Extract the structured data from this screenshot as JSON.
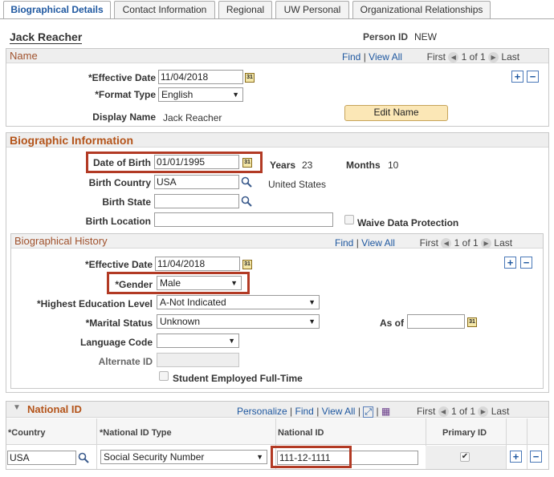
{
  "tabs": [
    "Biographical Details",
    "Contact Information",
    "Regional",
    "UW Personal",
    "Organizational Relationships"
  ],
  "person": {
    "name": "Jack Reacher",
    "person_id_label": "Person ID",
    "person_id_value": "NEW"
  },
  "name_section": {
    "title": "Name",
    "nav": {
      "find": "Find",
      "sep": "|",
      "view_all": "View All",
      "first": "First",
      "position": "1 of 1",
      "last": "Last"
    },
    "effective_date_label": "*Effective Date",
    "effective_date": "11/04/2018",
    "format_type_label": "*Format Type",
    "format_type": "English",
    "display_name_label": "Display Name",
    "display_name": "Jack Reacher",
    "edit_name_button": "Edit Name"
  },
  "bio_info": {
    "title": "Biographic Information",
    "dob_label": "Date of Birth",
    "dob": "01/01/1995",
    "years_label": "Years",
    "years": "23",
    "months_label": "Months",
    "months": "10",
    "birth_country_label": "Birth Country",
    "birth_country": "USA",
    "birth_country_desc": "United States",
    "birth_state_label": "Birth State",
    "birth_state": "",
    "birth_location_label": "Birth Location",
    "birth_location": "",
    "waive_label": "Waive Data Protection"
  },
  "bio_history": {
    "title": "Biographical History",
    "nav": {
      "find": "Find",
      "sep": "|",
      "view_all": "View All",
      "first": "First",
      "position": "1 of 1",
      "last": "Last"
    },
    "effective_date_label": "*Effective Date",
    "effective_date": "11/04/2018",
    "gender_label": "*Gender",
    "gender": "Male",
    "education_label": "*Highest Education Level",
    "education": "A-Not Indicated",
    "marital_label": "*Marital Status",
    "marital": "Unknown",
    "as_of_label": "As of",
    "as_of": "",
    "language_label": "Language Code",
    "language": "",
    "alternate_id_label": "Alternate ID",
    "alternate_id": "",
    "student_label": "Student Employed Full-Time"
  },
  "national_id": {
    "title": "National ID",
    "nav": {
      "personalize": "Personalize",
      "find": "Find",
      "sep": "|",
      "view_all": "View All",
      "first": "First",
      "position": "1 of 1",
      "last": "Last"
    },
    "columns": [
      "*Country",
      "*National ID Type",
      "National ID",
      "Primary ID"
    ],
    "row": {
      "country": "USA",
      "id_type": "Social Security Number",
      "national_id": "111-12-1111",
      "primary": "✔"
    }
  },
  "colors": {
    "accent": "#1f58a0",
    "section_title": "#a0522d",
    "highlight": "#b23a24"
  }
}
